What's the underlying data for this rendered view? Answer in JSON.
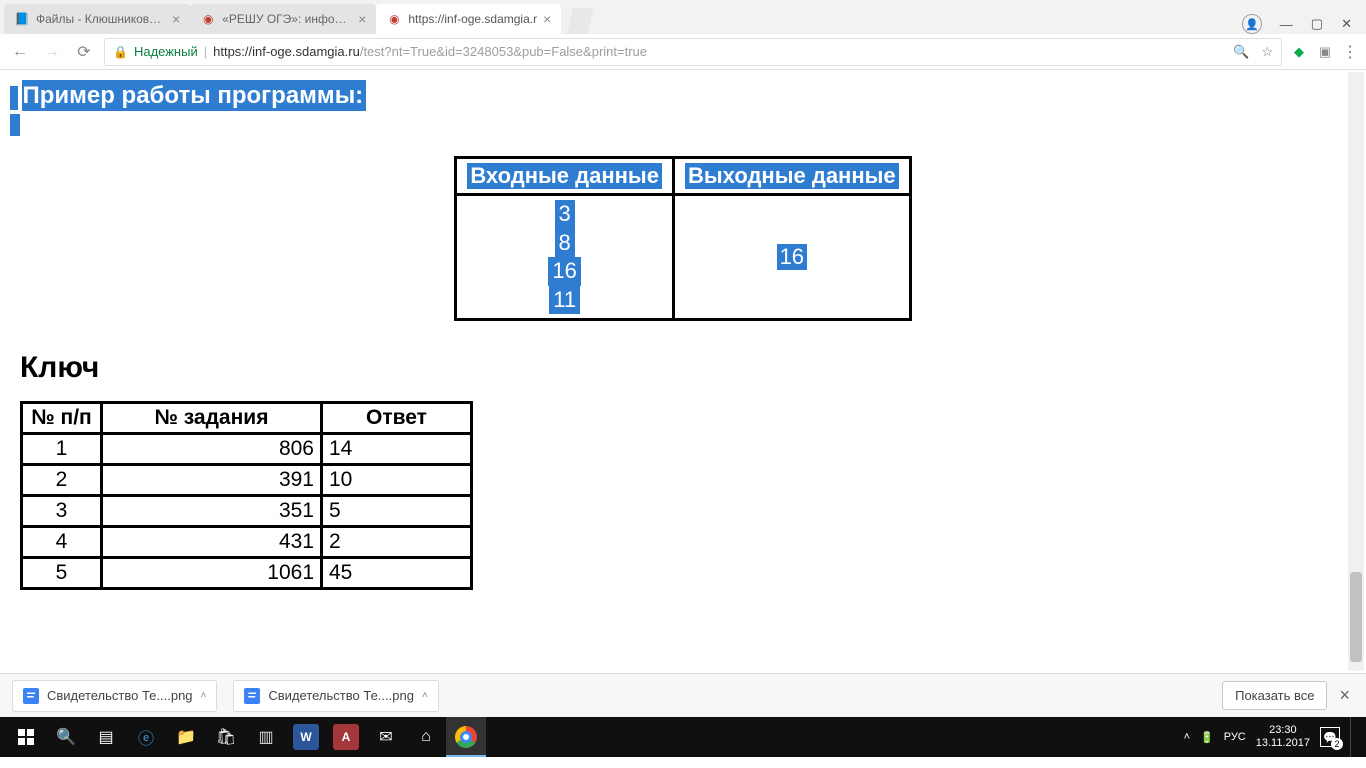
{
  "tabs": [
    {
      "title": "Файлы - Клюшникова К",
      "icon": "book"
    },
    {
      "title": "«РЕШУ ОГЭ»: информат",
      "icon": "target"
    },
    {
      "title": "https://inf-oge.sdamgia.r",
      "icon": "target",
      "active": true
    }
  ],
  "omnibox": {
    "secure": "Надежный",
    "host": "https://inf-oge.sdamgia.ru",
    "path": "/test?nt=True&id=3248053&pub=False&print=true"
  },
  "page": {
    "title": "Пример работы программы:",
    "example_table": {
      "headers": [
        "Входные данные",
        "Выходные данные"
      ],
      "input": [
        "3",
        "8",
        "16",
        "11"
      ],
      "output": "16"
    },
    "key_heading": "Ключ",
    "key_table": {
      "headers": [
        "№ п/п",
        "№ задания",
        "Ответ"
      ],
      "rows": [
        {
          "n": "1",
          "task": "806",
          "ans": "14"
        },
        {
          "n": "2",
          "task": "391",
          "ans": "10"
        },
        {
          "n": "3",
          "task": "351",
          "ans": "5"
        },
        {
          "n": "4",
          "task": "431",
          "ans": "2"
        },
        {
          "n": "5",
          "task": "1061",
          "ans": "45"
        }
      ]
    }
  },
  "downloads": {
    "items": [
      {
        "name": "Свидетельство Те....png"
      },
      {
        "name": "Свидетельство Те....png"
      }
    ],
    "show_all": "Показать все"
  },
  "taskbar": {
    "lang": "РУС",
    "time": "23:30",
    "date": "13.11.2017",
    "notif_count": "2"
  }
}
